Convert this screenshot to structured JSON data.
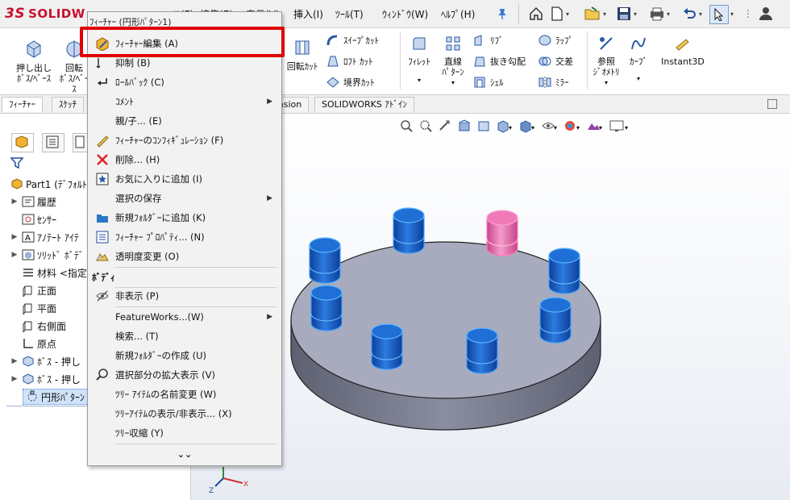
{
  "app": {
    "logo_text": "SOLIDW",
    "logo_prefix": "3S"
  },
  "menubar": {
    "items": [
      "ﾌｧｲﾙ(F)",
      "編集(E)",
      "表示(V)",
      "挿入(I)",
      "ﾂｰﾙ(T)",
      "ｳｨﾝﾄﾞｳ(W)",
      "ﾍﾙﾌﾟ(H)"
    ]
  },
  "ribbon": {
    "extrude": "押し出し\nﾎﾞｽ/ﾍﾞｰｽ",
    "revolve": "回転\nﾎﾞｽ/ﾍﾞｰｽ",
    "revolve_cut": "回転ｶｯﾄ",
    "sweep_cut": "ｽｲｰﾌﾟｶｯﾄ",
    "loft_cut": "ﾛﾌﾄ ｶｯﾄ",
    "boundary_cut": "境界ｶｯﾄ",
    "fillet": "ﾌｨﾚｯﾄ",
    "linear_pattern": "直線\nﾊﾟﾀｰﾝ",
    "rib": "ﾘﾌﾞ",
    "draft": "抜き勾配",
    "shell": "ｼｪﾙ",
    "wrap": "ﾗｯﾌﾟ",
    "intersect": "交差",
    "mirror": "ﾐﾗｰ",
    "ref_geometry": "参照\nｼﾞｵﾒﾄﾘ",
    "curves": "ｶｰﾌﾞ",
    "instant3d": "Instant3D"
  },
  "tabs": [
    "ﾌｨｰﾁｬｰ",
    "ｽｹｯﾁ",
    "ension",
    "SOLIDWORKS ｱﾄﾞｲﾝ"
  ],
  "tree": {
    "part": "Part1 (ﾃﾞﾌｫﾙﾄ",
    "items": [
      "履歴",
      "ｾﾝｻｰ",
      "ｱﾉﾃｰﾄ ｱｲﾃ",
      "ｿﾘｯﾄﾞ ﾎﾞﾃﾞ",
      "材料 <指定",
      "正面",
      "平面",
      "右側面",
      "原点",
      "ﾎﾞｽ - 押し",
      "ﾎﾞｽ - 押し",
      "円形ﾊﾟﾀｰﾝ"
    ]
  },
  "context_menu": {
    "title": "ﾌｨｰﾁｬｰ (円形ﾊﾟﾀｰﾝ1)",
    "items": [
      "ﾌｨｰﾁｬｰ編集 (A)",
      "抑制 (B)",
      "ﾛｰﾙﾊﾞｯｸ (C)",
      "ｺﾒﾝﾄ",
      "親/子... (E)",
      "ﾌｨｰﾁｬｰのｺﾝﾌｨｷﾞｭﾚｰｼｮﾝ (F)",
      "削除... (H)",
      "お気に入りに追加 (I)",
      "選択の保存",
      "新規ﾌｫﾙﾀﾞｰに追加 (K)",
      "ﾌｨｰﾁｬｰ ﾌﾟﾛﾊﾟﾃｨ... (N)",
      "透明度変更 (O)",
      "ﾎﾞﾃﾞｨ",
      "非表示 (P)",
      "FeatureWorks...(W)",
      "検索... (T)",
      "新規ﾌｫﾙﾀﾞｰの作成 (U)",
      "選択部分の拡大表示 (V)",
      "ﾂﾘｰ ｱｲﾃﾑの名前変更 (W)",
      "ﾂﾘｰｱｲﾃﾑの表示/非表示... (X)",
      "ﾂﾘｰ収縮 (Y)"
    ]
  },
  "triad": {
    "x": "X",
    "z": "Z"
  },
  "colors": {
    "accent_red": "#e00000",
    "feature_blue": "#1f6fd6",
    "selected_pink": "#f07ab8",
    "disk_gray": "#a7abbd"
  }
}
